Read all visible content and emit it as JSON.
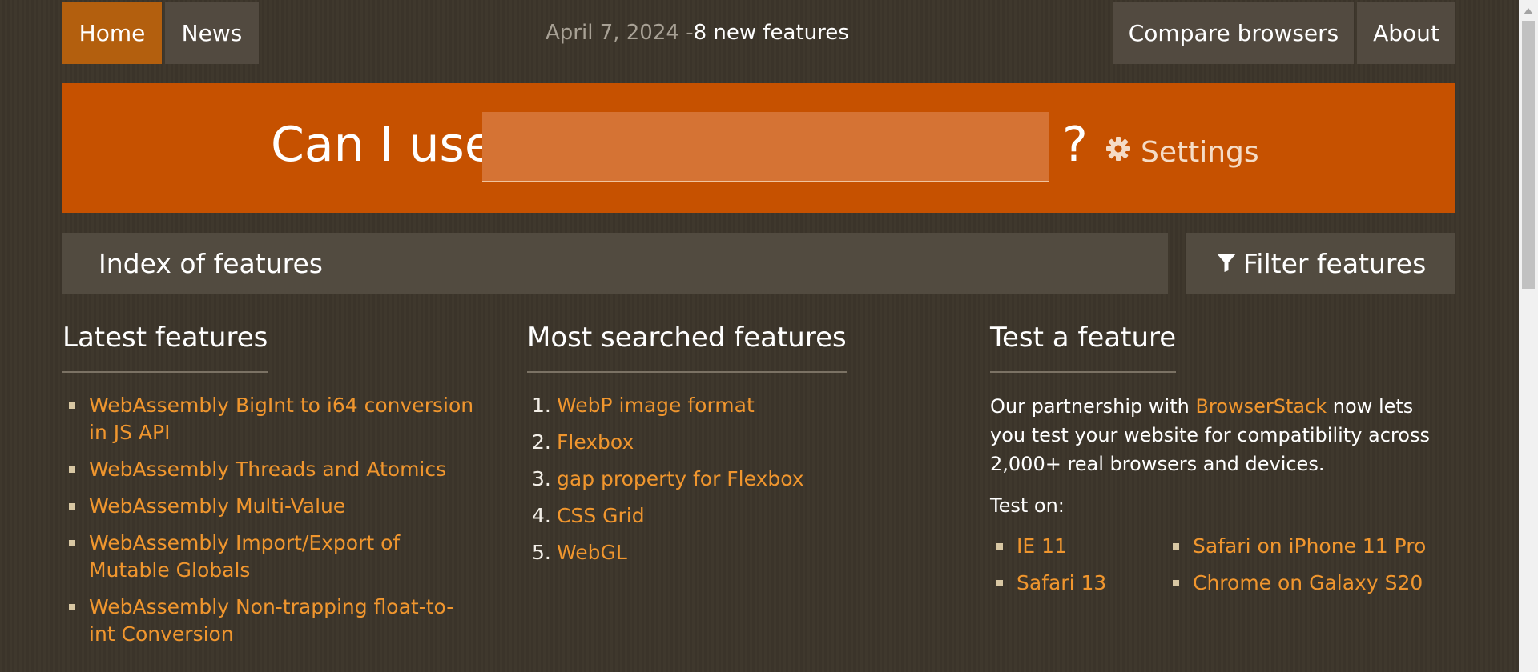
{
  "nav": {
    "home": "Home",
    "news": "News",
    "news_date": "April 7, 2024 - ",
    "news_count": "8 new features",
    "compare": "Compare browsers",
    "about": "About"
  },
  "hero": {
    "label": "Can I use",
    "input_value": "",
    "question_mark": "?",
    "settings": "Settings"
  },
  "index_bar": {
    "title": "Index of features",
    "filter": "Filter features"
  },
  "latest": {
    "heading": "Latest features",
    "items": [
      "WebAssembly BigInt to i64 conversion in JS API",
      "WebAssembly Threads and Atomics",
      "WebAssembly Multi-Value",
      "WebAssembly Import/Export of Mutable Globals",
      "WebAssembly Non-trapping float-to-int Conversion"
    ]
  },
  "most_searched": {
    "heading": "Most searched features",
    "items": [
      {
        "n": "1.",
        "label": "WebP image format"
      },
      {
        "n": "2.",
        "label": "Flexbox"
      },
      {
        "n": "3.",
        "label": "gap property for Flexbox"
      },
      {
        "n": "4.",
        "label": "CSS Grid"
      },
      {
        "n": "5.",
        "label": "WebGL"
      }
    ]
  },
  "test": {
    "heading": "Test a feature",
    "text_before": "Our partnership with ",
    "link": "BrowserStack",
    "text_after": " now lets you test your website for compatibility across 2,000+ real browsers and devices.",
    "test_on": "Test on:",
    "browsers": [
      "IE 11",
      "Safari on iPhone 11 Pro",
      "Safari 13",
      "Chrome on Galaxy S20"
    ]
  },
  "colors": {
    "accent": "#c65100",
    "link": "#f0962e",
    "nav_active": "#b35f0e"
  }
}
